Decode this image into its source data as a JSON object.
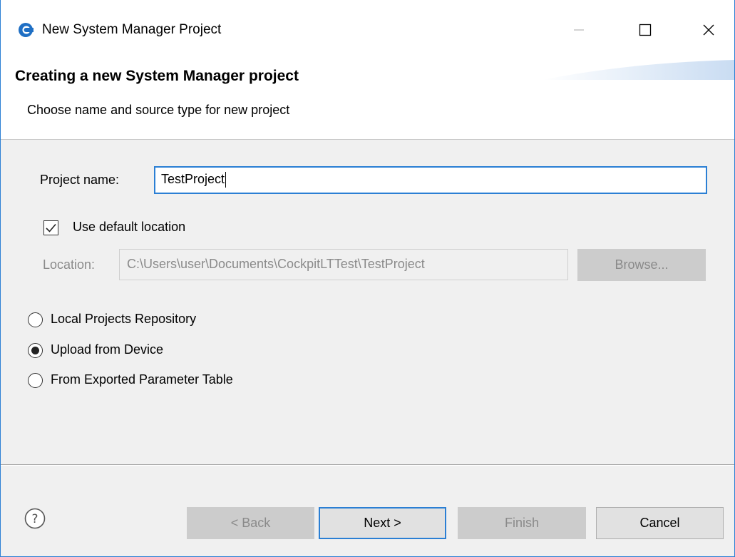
{
  "window": {
    "title": "New System Manager Project",
    "app_icon": "eclipse-cockpit-icon",
    "controls": [
      "minimize-icon",
      "maximize-icon",
      "close-icon"
    ]
  },
  "header": {
    "title": "Creating a new System Manager project",
    "subtitle": "Choose name and source type for new project"
  },
  "form": {
    "project_name_label": "Project name:",
    "project_name_value": "TestProject",
    "use_default_location_label": "Use default location",
    "use_default_location_checked": true,
    "location_label": "Location:",
    "location_value": "C:\\Users\\user\\Documents\\CockpitLTTest\\TestProject",
    "browse_label": "Browse..."
  },
  "source_options": [
    {
      "label": "Local Projects Repository",
      "selected": false
    },
    {
      "label": "Upload from Device",
      "selected": true
    },
    {
      "label": "From Exported Parameter Table",
      "selected": false
    }
  ],
  "footer": {
    "help_icon": "help-icon",
    "back_label": "< Back",
    "next_label": "Next >",
    "finish_label": "Finish",
    "cancel_label": "Cancel"
  },
  "colors": {
    "accent": "#2b7fd4",
    "dialog_bg": "#f0f0f0",
    "disabled_text": "#8a8a8a",
    "disabled_button_bg": "#cccccc"
  }
}
